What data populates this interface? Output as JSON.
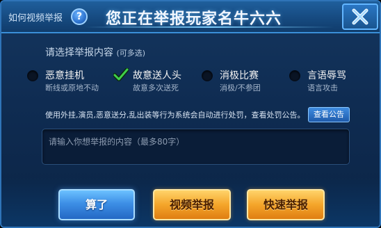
{
  "header": {
    "howto_link": "如何视频举报",
    "help_icon": "help-icon",
    "help_glyph": "?",
    "title": "您正在举报玩家名牛六六",
    "close_icon": "close-icon"
  },
  "report": {
    "section_label": "请选择举报内容",
    "section_hint": "(可多选)",
    "options": [
      {
        "title": "恶意挂机",
        "subtitle": "断线或原地不动",
        "checked": false
      },
      {
        "title": "故意送人头",
        "subtitle": "故意多次送死",
        "checked": true
      },
      {
        "title": "消极比赛",
        "subtitle": "消极/不参团",
        "checked": false
      },
      {
        "title": "言语辱骂",
        "subtitle": "语言攻击",
        "checked": false
      }
    ],
    "notice": "使用外挂,演员,恶意送分,乱出装等行为系统会自动进行处罚，查看处罚公告。",
    "view_notice_button": "查看公告",
    "input_placeholder": "请输入你想举报的内容（最多80字）",
    "input_value": ""
  },
  "buttons": {
    "cancel": "算了",
    "video_report": "视频举报",
    "quick_report": "快速举报"
  },
  "colors": {
    "accent_blue": "#3d8fe6",
    "accent_orange": "#f4a52a",
    "check_green": "#3fd04a"
  }
}
